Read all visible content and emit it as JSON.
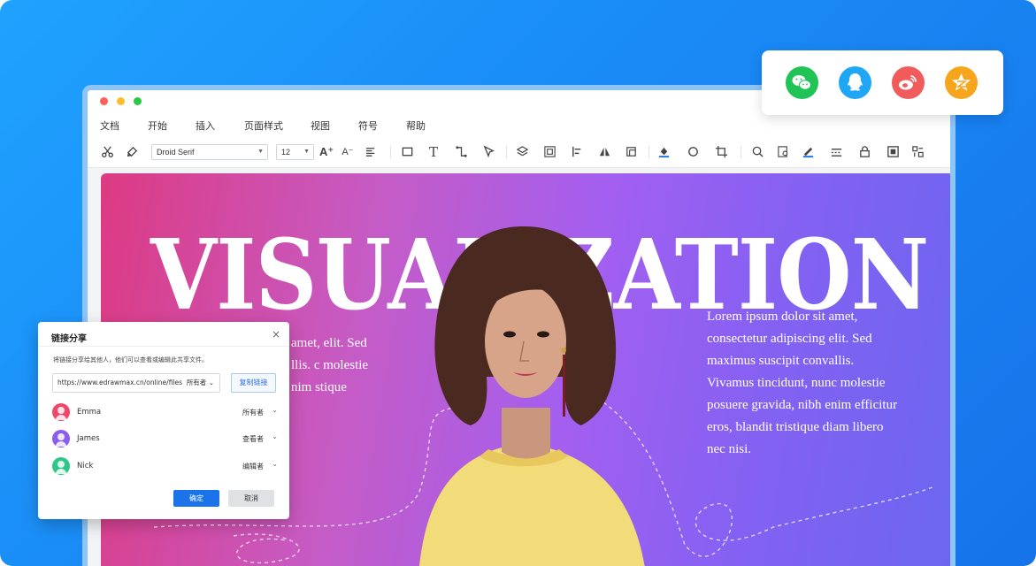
{
  "menu": [
    "文档",
    "开始",
    "插入",
    "页面样式",
    "视图",
    "符号",
    "帮助"
  ],
  "toolbar": {
    "font_family": "Droid Serif",
    "font_size": "12"
  },
  "canvas": {
    "headline": "VISUALIZATION",
    "lorem_right": "Lorem ipsum dolor sit amet, consectetur adipiscing elit. Sed maximus suscipit convallis. Vivamus tincidunt, nunc molestie posuere gravida, nibh enim efficitur eros, blandit tristique diam libero nec nisi.",
    "lorem_left": "amet, elit. Sed llis. c molestie nim stique"
  },
  "dialog": {
    "title": "链接分享",
    "close": "×",
    "description": "将链接分享给其他人，他们可以查看或编辑此共享文件。",
    "url": "https://www.edrawmax.cn/online/files",
    "url_permission": "所有者",
    "copy_label": "复制链接",
    "users": [
      {
        "name": "Emma",
        "role": "所有者",
        "color": "#f0466a"
      },
      {
        "name": "James",
        "role": "查看者",
        "color": "#8a5cf0"
      },
      {
        "name": "Nick",
        "role": "编辑者",
        "color": "#2ec78a"
      }
    ],
    "ok_label": "确定",
    "cancel_label": "取消"
  },
  "share_icons": [
    {
      "name": "wechat-icon",
      "color": "#1fc356"
    },
    {
      "name": "qq-icon",
      "color": "#1fa6f5"
    },
    {
      "name": "weibo-icon",
      "color": "#f15b5b"
    },
    {
      "name": "qzone-icon",
      "color": "#f7a51c"
    }
  ],
  "colors": {
    "accent": "#1a73e8",
    "background": "#1a8cf6"
  }
}
